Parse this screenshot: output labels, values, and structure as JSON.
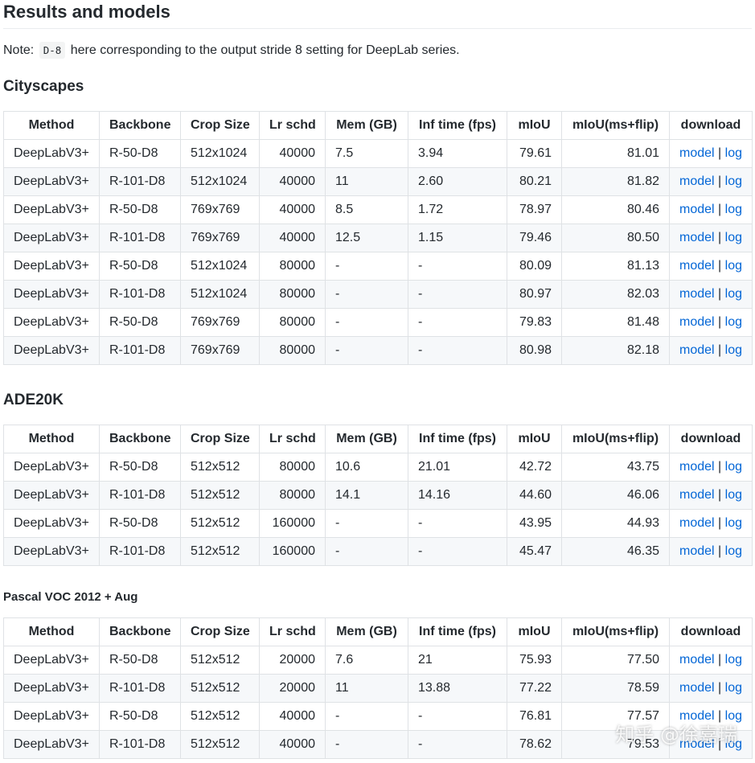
{
  "heading": "Results and models",
  "note": {
    "prefix": "Note:",
    "code": "D-8",
    "suffix": "here corresponding to the output stride 8 setting for DeepLab series."
  },
  "columns": [
    "Method",
    "Backbone",
    "Crop Size",
    "Lr schd",
    "Mem (GB)",
    "Inf time (fps)",
    "mIoU",
    "mIoU(ms+flip)",
    "download"
  ],
  "link_labels": {
    "model": "model",
    "separator": "|",
    "log": "log"
  },
  "sections": [
    {
      "title": "Cityscapes",
      "rows": [
        [
          "DeepLabV3+",
          "R-50-D8",
          "512x1024",
          "40000",
          "7.5",
          "3.94",
          "79.61",
          "81.01"
        ],
        [
          "DeepLabV3+",
          "R-101-D8",
          "512x1024",
          "40000",
          "11",
          "2.60",
          "80.21",
          "81.82"
        ],
        [
          "DeepLabV3+",
          "R-50-D8",
          "769x769",
          "40000",
          "8.5",
          "1.72",
          "78.97",
          "80.46"
        ],
        [
          "DeepLabV3+",
          "R-101-D8",
          "769x769",
          "40000",
          "12.5",
          "1.15",
          "79.46",
          "80.50"
        ],
        [
          "DeepLabV3+",
          "R-50-D8",
          "512x1024",
          "80000",
          "-",
          "-",
          "80.09",
          "81.13"
        ],
        [
          "DeepLabV3+",
          "R-101-D8",
          "512x1024",
          "80000",
          "-",
          "-",
          "80.97",
          "82.03"
        ],
        [
          "DeepLabV3+",
          "R-50-D8",
          "769x769",
          "80000",
          "-",
          "-",
          "79.83",
          "81.48"
        ],
        [
          "DeepLabV3+",
          "R-101-D8",
          "769x769",
          "80000",
          "-",
          "-",
          "80.98",
          "82.18"
        ]
      ]
    },
    {
      "title": "ADE20K",
      "rows": [
        [
          "DeepLabV3+",
          "R-50-D8",
          "512x512",
          "80000",
          "10.6",
          "21.01",
          "42.72",
          "43.75"
        ],
        [
          "DeepLabV3+",
          "R-101-D8",
          "512x512",
          "80000",
          "14.1",
          "14.16",
          "44.60",
          "46.06"
        ],
        [
          "DeepLabV3+",
          "R-50-D8",
          "512x512",
          "160000",
          "-",
          "-",
          "43.95",
          "44.93"
        ],
        [
          "DeepLabV3+",
          "R-101-D8",
          "512x512",
          "160000",
          "-",
          "-",
          "45.47",
          "46.35"
        ]
      ]
    },
    {
      "title": "Pascal VOC 2012 + Aug",
      "rows": [
        [
          "DeepLabV3+",
          "R-50-D8",
          "512x512",
          "20000",
          "7.6",
          "21",
          "75.93",
          "77.50"
        ],
        [
          "DeepLabV3+",
          "R-101-D8",
          "512x512",
          "20000",
          "11",
          "13.88",
          "77.22",
          "78.59"
        ],
        [
          "DeepLabV3+",
          "R-50-D8",
          "512x512",
          "40000",
          "-",
          "-",
          "76.81",
          "77.57"
        ],
        [
          "DeepLabV3+",
          "R-101-D8",
          "512x512",
          "40000",
          "-",
          "-",
          "78.62",
          "79.53"
        ]
      ]
    }
  ],
  "watermark": "知乎 @徐嘉瑞"
}
